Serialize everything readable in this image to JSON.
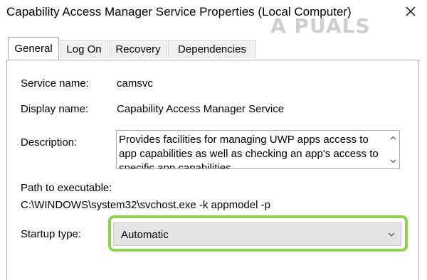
{
  "window": {
    "title": "Capability Access Manager Service Properties (Local Computer)",
    "watermark": "A PUALS"
  },
  "tabs": [
    {
      "label": "General",
      "active": true
    },
    {
      "label": "Log On",
      "active": false
    },
    {
      "label": "Recovery",
      "active": false
    },
    {
      "label": "Dependencies",
      "active": false
    }
  ],
  "general": {
    "service_name_label": "Service name:",
    "service_name_value": "camsvc",
    "display_name_label": "Display name:",
    "display_name_value": "Capability Access Manager Service",
    "description_label": "Description:",
    "description_text": "Provides facilities for managing UWP apps access to app capabilities as well as checking an app's access to specific app capabilities",
    "path_label": "Path to executable:",
    "path_value": "C:\\WINDOWS\\system32\\svchost.exe -k appmodel -p",
    "startup_type_label": "Startup type:",
    "startup_type_value": "Automatic"
  },
  "colors": {
    "highlight": "#8ed24b",
    "select_bg": "#e5e5e5"
  },
  "icons": {
    "close": "close-icon",
    "scroll_up": "chevron-up-icon",
    "scroll_down": "chevron-down-icon",
    "dropdown": "chevron-down-icon"
  }
}
